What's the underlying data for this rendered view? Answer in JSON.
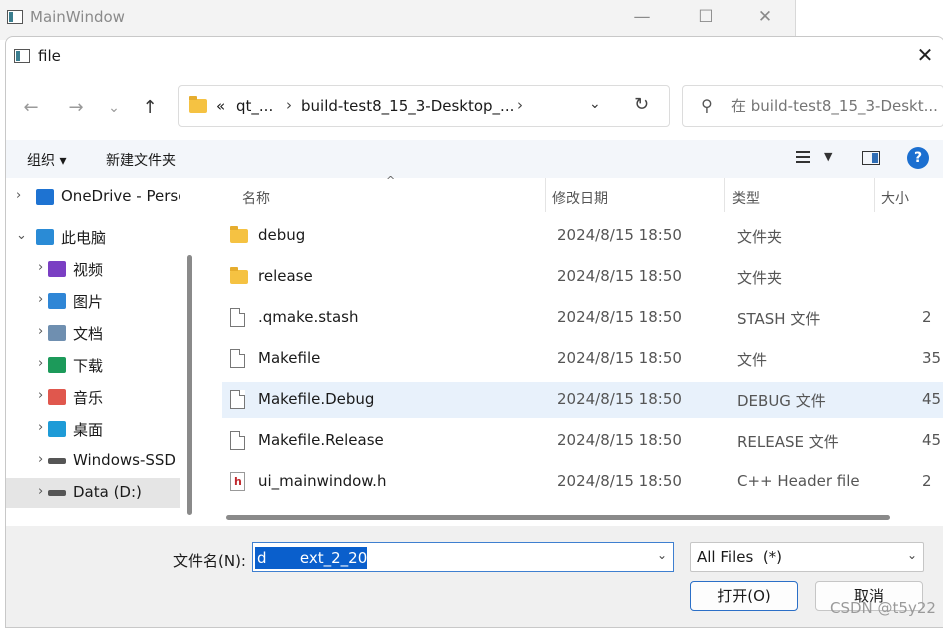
{
  "main_window": {
    "title": "MainWindow",
    "minimize": "—",
    "maximize": "☐",
    "close": "✕"
  },
  "dialog": {
    "title": "file",
    "close": "✕"
  },
  "nav": {
    "back": "←",
    "forward": "→",
    "recent": "⌄",
    "up": "↑"
  },
  "address": {
    "overflow": "«",
    "crumbs": [
      "qt_...",
      "build-test8_15_3-Desktop_..."
    ],
    "sep": "›",
    "dropdown": "⌄",
    "refresh": "↻"
  },
  "search": {
    "placeholder": "在 build-test8_15_3-Deskt..."
  },
  "commandbar": {
    "organize": "组织 ▾",
    "new_folder": "新建文件夹",
    "view_dropdown": "▼",
    "help": "?"
  },
  "navpane": {
    "items": [
      {
        "chevron": "›",
        "label": "OneDrive - Perso",
        "icon": "cloud-icon",
        "color": "#1e73d2"
      },
      {
        "chevron": "⌄",
        "label": "此电脑",
        "icon": "computer-icon",
        "color": "#2a8bd6"
      },
      {
        "chevron": "›",
        "label": "视频",
        "icon": "video-icon",
        "color": "#7a3fc3"
      },
      {
        "chevron": "›",
        "label": "图片",
        "icon": "pictures-icon",
        "color": "#2f86d6"
      },
      {
        "chevron": "›",
        "label": "文档",
        "icon": "documents-icon",
        "color": "#6f8fb0"
      },
      {
        "chevron": "›",
        "label": "下载",
        "icon": "download-icon",
        "color": "#1c9a5a"
      },
      {
        "chevron": "›",
        "label": "音乐",
        "icon": "music-icon",
        "color": "#e0574d"
      },
      {
        "chevron": "›",
        "label": "桌面",
        "icon": "desktop-icon",
        "color": "#1e9bd7"
      },
      {
        "chevron": "›",
        "label": "Windows-SSD (",
        "icon": "drive-icon",
        "color": "#555555"
      },
      {
        "chevron": "›",
        "label": "Data (D:)",
        "icon": "drive-icon",
        "color": "#555555"
      }
    ],
    "selected_index": 9
  },
  "filelist": {
    "columns": [
      "名称",
      "修改日期",
      "类型",
      "大小"
    ],
    "sort_indicator": "^",
    "rows": [
      {
        "name": "debug",
        "date": "2024/8/15 18:50",
        "type": "文件夹",
        "size": "",
        "kind": "folder"
      },
      {
        "name": "release",
        "date": "2024/8/15 18:50",
        "type": "文件夹",
        "size": "",
        "kind": "folder"
      },
      {
        "name": ".qmake.stash",
        "date": "2024/8/15 18:50",
        "type": "STASH 文件",
        "size": "2",
        "kind": "doc"
      },
      {
        "name": "Makefile",
        "date": "2024/8/15 18:50",
        "type": "文件",
        "size": "35",
        "kind": "doc"
      },
      {
        "name": "Makefile.Debug",
        "date": "2024/8/15 18:50",
        "type": "DEBUG 文件",
        "size": "45",
        "kind": "doc"
      },
      {
        "name": "Makefile.Release",
        "date": "2024/8/15 18:50",
        "type": "RELEASE 文件",
        "size": "45",
        "kind": "doc"
      },
      {
        "name": "ui_mainwindow.h",
        "date": "2024/8/15 18:50",
        "type": "C++ Header file",
        "size": "2",
        "kind": "hdr"
      }
    ],
    "selected_index": 4
  },
  "bottom": {
    "filename_label": "文件名(N):",
    "filename_value": "d       ext_2_20",
    "filetype_value": "All Files  (*)",
    "dropdown": "⌄",
    "open_label": "打开(O)",
    "cancel_label": "取消",
    "watermark": "CSDN @t5y22"
  }
}
